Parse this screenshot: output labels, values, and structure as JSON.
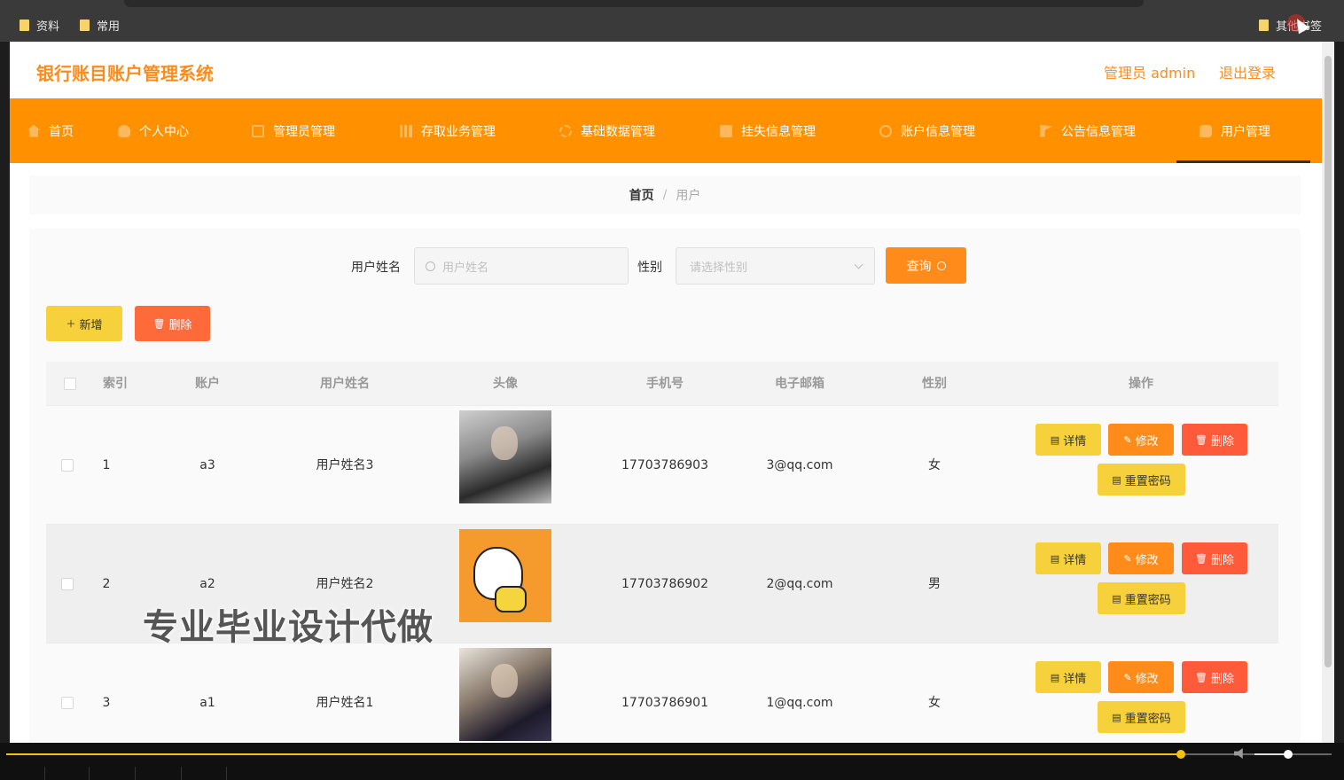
{
  "browser": {
    "bookmarks": [
      "资料",
      "常用",
      "其他书签"
    ]
  },
  "header": {
    "site_title": "银行账目账户管理系统",
    "admin_label": "管理员 admin",
    "logout": "退出登录"
  },
  "nav": {
    "items": [
      {
        "label": "首页",
        "icon": "home-icon"
      },
      {
        "label": "个人中心",
        "icon": "user-icon"
      },
      {
        "label": "管理员管理",
        "icon": "box-icon"
      },
      {
        "label": "存取业务管理",
        "icon": "bar-chart-icon"
      },
      {
        "label": "基础数据管理",
        "icon": "gear-icon"
      },
      {
        "label": "挂失信息管理",
        "icon": "document-icon"
      },
      {
        "label": "账户信息管理",
        "icon": "clock-icon"
      },
      {
        "label": "公告信息管理",
        "icon": "flag-icon"
      },
      {
        "label": "用户管理",
        "icon": "chat-icon"
      }
    ],
    "active": "用户管理"
  },
  "breadcrumb": {
    "home": "首页",
    "separator": "/",
    "current": "用户"
  },
  "search": {
    "name_label": "用户姓名",
    "name_placeholder": "用户姓名",
    "gender_label": "性别",
    "gender_placeholder": "请选择性别",
    "query_button": "查询"
  },
  "actions": {
    "add": "新增",
    "delete": "删除"
  },
  "table": {
    "headers": [
      "索引",
      "账户",
      "用户姓名",
      "头像",
      "手机号",
      "电子邮箱",
      "性别",
      "操作"
    ],
    "rows": [
      {
        "index": "1",
        "account": "a3",
        "name": "用户姓名3",
        "phone": "17703786903",
        "email": "3@qq.com",
        "gender": "女"
      },
      {
        "index": "2",
        "account": "a2",
        "name": "用户姓名2",
        "phone": "17703786902",
        "email": "2@qq.com",
        "gender": "男"
      },
      {
        "index": "3",
        "account": "a1",
        "name": "用户姓名1",
        "phone": "17703786901",
        "email": "1@qq.com",
        "gender": "女"
      }
    ],
    "row_actions": {
      "detail": "详情",
      "edit": "修改",
      "delete": "删除",
      "reset_password": "重置密码"
    }
  },
  "watermark": "专业毕业设计代做",
  "player": {
    "progress": 0.886,
    "volume": 0.47
  },
  "colors": {
    "primary": "#ff9100",
    "accent_text": "#ff8c1a",
    "warning_yellow": "#f7d13b",
    "danger": "#ff5a3a"
  }
}
